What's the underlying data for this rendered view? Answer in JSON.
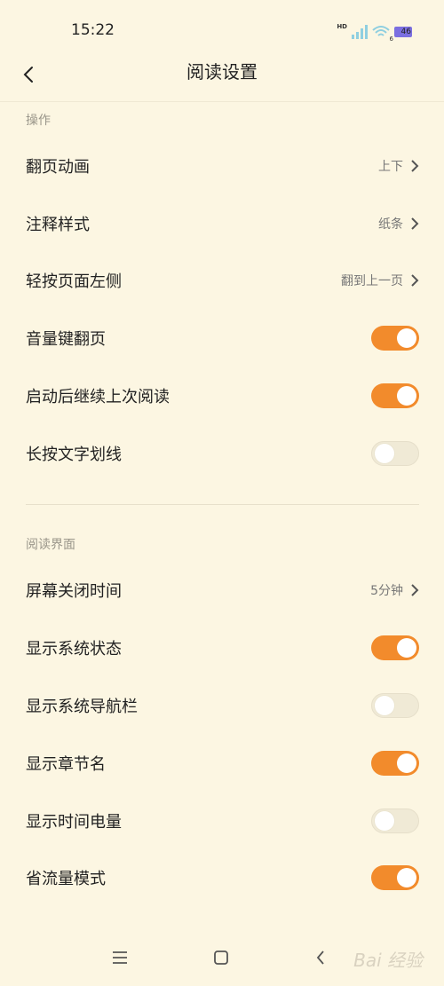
{
  "status_bar": {
    "time": "15:22",
    "hd": "HD",
    "wifi_num": "6",
    "battery": "46"
  },
  "header": {
    "title": "阅读设置"
  },
  "sections": {
    "operation": {
      "title": "操作",
      "items": [
        {
          "label": "翻页动画",
          "value": "上下"
        },
        {
          "label": "注释样式",
          "value": "纸条"
        },
        {
          "label": "轻按页面左侧",
          "value": "翻到上一页"
        },
        {
          "label": "音量键翻页",
          "on": true
        },
        {
          "label": "启动后继续上次阅读",
          "on": true
        },
        {
          "label": "长按文字划线",
          "on": false
        }
      ]
    },
    "reading": {
      "title": "阅读界面",
      "items": [
        {
          "label": "屏幕关闭时间",
          "value": "5分钟"
        },
        {
          "label": "显示系统状态",
          "on": true
        },
        {
          "label": "显示系统导航栏",
          "on": false
        },
        {
          "label": "显示章节名",
          "on": true
        },
        {
          "label": "显示时间电量",
          "on": false
        },
        {
          "label": "省流量模式",
          "on": true
        }
      ]
    }
  },
  "watermark": "Bai 经验",
  "colors": {
    "accent": "#f28b2c",
    "background": "#fcf6e2"
  }
}
